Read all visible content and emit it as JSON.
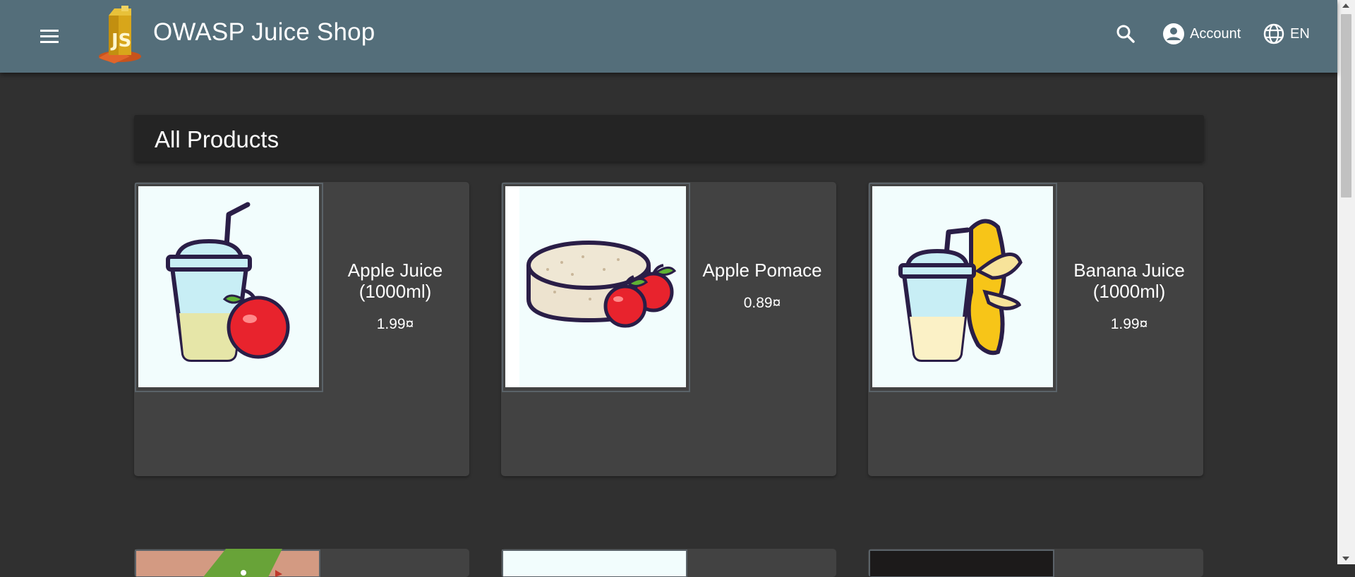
{
  "toolbar": {
    "app_title": "OWASP Juice Shop",
    "menu_icon": "menu-icon",
    "search_icon": "search-icon",
    "account_label": "Account",
    "language_label": "EN",
    "background_color": "#546e7a"
  },
  "main": {
    "section_title": "All Products",
    "products": [
      {
        "name": "Apple Juice (1000ml)",
        "price": "1.99¤",
        "image": "apple-juice-image"
      },
      {
        "name": "Apple Pomace",
        "price": "0.89¤",
        "image": "apple-pomace-image"
      },
      {
        "name": "Banana Juice (1000ml)",
        "price": "1.99¤",
        "image": "banana-juice-image"
      }
    ]
  },
  "colors": {
    "page_background": "#303030",
    "card_background": "#424242",
    "header_background": "#242424",
    "accent_green": "#68a338"
  }
}
